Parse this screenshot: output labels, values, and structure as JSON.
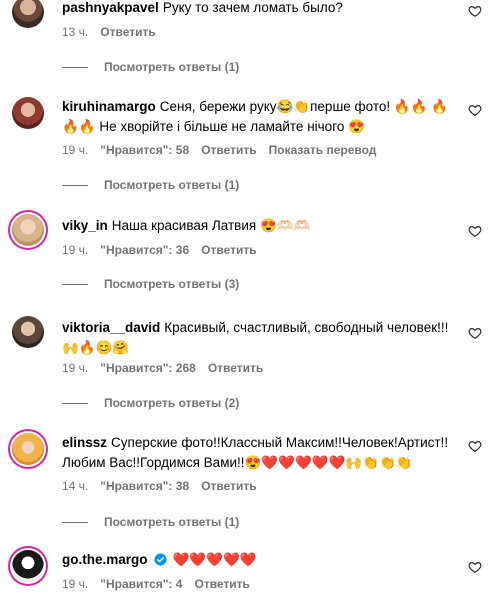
{
  "comments": [
    {
      "username": "pashnyakpavel",
      "text": "Руку то зачем ломать было?",
      "time": "13 ч.",
      "reply": "Ответить"
    },
    {
      "username": "kiruhinamargo",
      "text": "Сеня, бережи руку😂👏перше фото! 🔥🔥 🔥🔥🔥 Не хворійте і більше не ламайте нічого 😍",
      "time": "19 ч.",
      "likes": "\"Нравится\": 58",
      "reply": "Ответить",
      "translate": "Показать перевод"
    },
    {
      "username": "viky_in",
      "text": "Наша красивая Латвия 😍🫶🏻🫶🏻",
      "time": "19 ч.",
      "likes": "\"Нравится\": 36",
      "reply": "Ответить"
    },
    {
      "username": "viktoria__david",
      "text": "Красивый, счастливый, свободный человек!!! 🙌🔥😊🤗",
      "time": "19 ч.",
      "likes": "\"Нравится\": 268",
      "reply": "Ответить"
    },
    {
      "username": "elinssz",
      "text": "Суперские фото!!Классный Максим!!Человек!Артист!! Любим Вас!!Гордимся Вами!!😍❤️❤️❤️❤️❤️🙌👏👏👏",
      "time": "14 ч.",
      "likes": "\"Нравится\": 38",
      "reply": "Ответить"
    },
    {
      "username": "go.the.margo",
      "text": "❤️❤️❤️❤️❤️",
      "time": "19 ч.",
      "likes": "\"Нравится\": 4",
      "reply": "Ответить"
    }
  ],
  "view_replies": [
    "Посмотреть ответы (1)",
    "Посмотреть ответы (1)",
    "Посмотреть ответы (3)",
    "Посмотреть ответы (2)",
    "Посмотреть ответы (1)"
  ],
  "colors": {
    "secondary_text": "#737373",
    "verified_badge": "#0095f6",
    "story_ring": "#d6249f"
  }
}
